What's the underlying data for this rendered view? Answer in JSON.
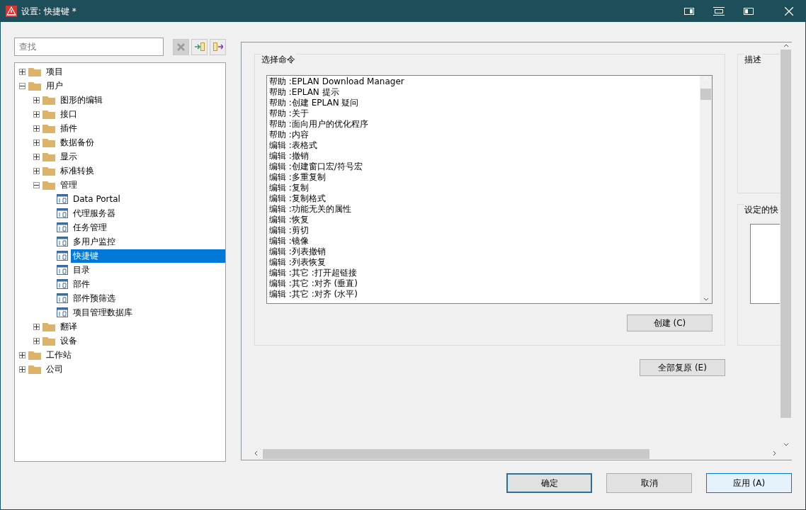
{
  "window": {
    "title": "设置: 快捷键 *"
  },
  "search": {
    "placeholder": "查找"
  },
  "tree": [
    {
      "label": "项目",
      "kind": "folder",
      "expanded": false,
      "selected": false
    },
    {
      "label": "用户",
      "kind": "folder",
      "expanded": true,
      "selected": false,
      "children": [
        {
          "label": "图形的编辑",
          "kind": "folder",
          "expanded": false,
          "selected": false
        },
        {
          "label": "接口",
          "kind": "folder",
          "expanded": false,
          "selected": false
        },
        {
          "label": "插件",
          "kind": "folder",
          "expanded": false,
          "selected": false
        },
        {
          "label": "数据备份",
          "kind": "folder",
          "expanded": false,
          "selected": false
        },
        {
          "label": "显示",
          "kind": "folder",
          "expanded": false,
          "selected": false
        },
        {
          "label": "标准转换",
          "kind": "folder",
          "expanded": false,
          "selected": false
        },
        {
          "label": "管理",
          "kind": "folder",
          "expanded": true,
          "selected": false,
          "children": [
            {
              "label": "Data Portal",
              "kind": "page",
              "selected": false
            },
            {
              "label": "代理服务器",
              "kind": "page",
              "selected": false
            },
            {
              "label": "任务管理",
              "kind": "page",
              "selected": false
            },
            {
              "label": "多用户监控",
              "kind": "page",
              "selected": false
            },
            {
              "label": "快捷键",
              "kind": "page",
              "selected": true
            },
            {
              "label": "目录",
              "kind": "page",
              "selected": false
            },
            {
              "label": "部件",
              "kind": "page",
              "selected": false
            },
            {
              "label": "部件预筛选",
              "kind": "page",
              "selected": false
            },
            {
              "label": "项目管理数据库",
              "kind": "page",
              "selected": false
            }
          ]
        },
        {
          "label": "翻译",
          "kind": "folder",
          "expanded": false,
          "selected": false
        },
        {
          "label": "设备",
          "kind": "folder",
          "expanded": false,
          "selected": false
        }
      ]
    },
    {
      "label": "工作站",
      "kind": "folder",
      "expanded": false,
      "selected": false
    },
    {
      "label": "公司",
      "kind": "folder",
      "expanded": false,
      "selected": false
    }
  ],
  "command_group": {
    "title": "选择命令",
    "create_button": "创建 (C)",
    "commands": [
      "帮助 :EPLAN Download Manager",
      "帮助 :EPLAN 提示",
      "帮助 :创建 EPLAN 疑问",
      "帮助 :关于",
      "帮助 :面向用户的优化程序",
      "帮助 :内容",
      "编辑 :表格式",
      "编辑 :撤销",
      "编辑 :创建窗口宏/符号宏",
      "编辑 :多重复制",
      "编辑 :复制",
      "编辑 :复制格式",
      "编辑 :功能无关的属性",
      "编辑 :恢复",
      "编辑 :剪切",
      "编辑 :镜像",
      "编辑 :列表撤销",
      "编辑 :列表恢复",
      "编辑 :其它 :打开超链接",
      "编辑 :其它 :对齐 (垂直)",
      "编辑 :其它 :对齐 (水平)"
    ]
  },
  "description_group": {
    "title": "描述"
  },
  "shortcut_group": {
    "title": "设定的快"
  },
  "reset_button": "全部复原 (E)",
  "buttons": [
    {
      "label": "确定",
      "kind": "focused"
    },
    {
      "label": "取消",
      "kind": "normal"
    },
    {
      "label": "应用 (A)",
      "kind": "hot"
    }
  ]
}
